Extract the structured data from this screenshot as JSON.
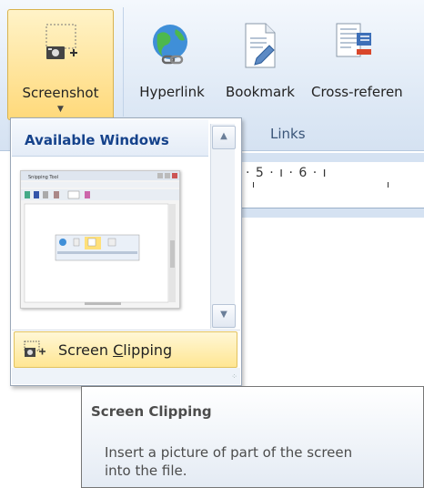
{
  "ribbon": {
    "screenshot_label": "Screenshot",
    "screenshot_arrow": "▼",
    "hyperlink_label": "Hyperlink",
    "bookmark_label": "Bookmark",
    "crossref_label": "Cross-referen",
    "group_label": "Links"
  },
  "ruler": {
    "text": "·  5  ·  ı  ·  6  ·  ı"
  },
  "dropdown": {
    "header": "Available Windows",
    "thumbnail_title": "Snipping Tool",
    "clip_label_pre": "Screen ",
    "clip_label_accel": "C",
    "clip_label_post": "lipping"
  },
  "tooltip": {
    "title": "Screen Clipping",
    "description": "Insert a picture of part of the screen into the file."
  },
  "colors": {
    "ribbon_bg": "#dde8f5",
    "hover": "#ffe693",
    "accent": "#15428b"
  },
  "icons": [
    "screenshot-icon",
    "globe-link-icon",
    "bookmark-icon",
    "cross-reference-icon",
    "screen-clipping-icon"
  ]
}
